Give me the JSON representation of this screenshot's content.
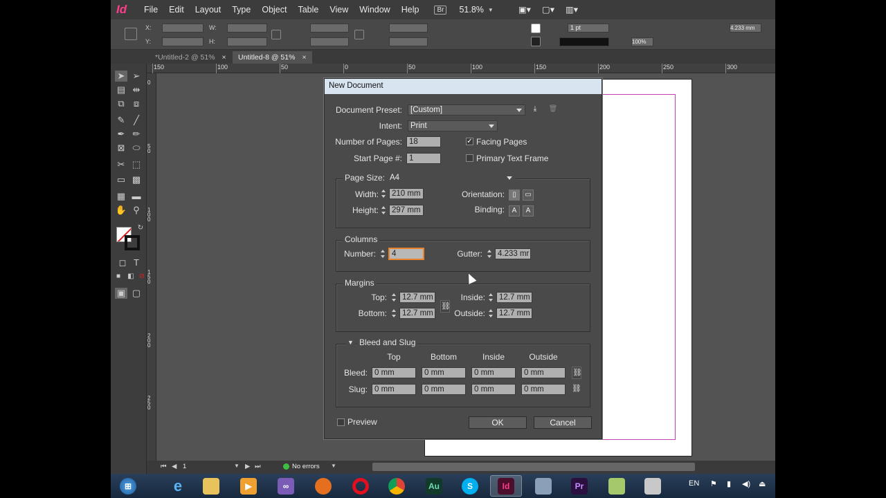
{
  "app": {
    "logo": "Id",
    "menus": [
      "File",
      "Edit",
      "Layout",
      "Type",
      "Object",
      "Table",
      "View",
      "Window",
      "Help"
    ],
    "bridge_badge": "Br",
    "zoom": "51.8%",
    "accent": "#ff3c8a"
  },
  "control_bar": {
    "x_label": "X:",
    "y_label": "Y:",
    "w_label": "W:",
    "h_label": "H:",
    "stroke_weight": "1 pt",
    "opacity": "100%",
    "spacing": "4.233 mm"
  },
  "tabs": [
    {
      "label": "*Untitled-2 @ 51%",
      "close": "×",
      "active": false
    },
    {
      "label": "Untitled-8 @ 51%",
      "close": "×",
      "active": true
    }
  ],
  "ruler_top": [
    "150",
    "100",
    "50",
    "0",
    "50",
    "100",
    "150",
    "200",
    "250",
    "300"
  ],
  "ruler_left": [
    "0",
    "5 0",
    "1 0 0",
    "1 5 0",
    "2 0 0",
    "2 5 0"
  ],
  "status": {
    "page": "1",
    "errors": "No errors"
  },
  "dialog": {
    "title": "New Document",
    "document_preset_label": "Document Preset:",
    "document_preset_value": "[Custom]",
    "intent_label": "Intent:",
    "intent_value": "Print",
    "num_pages_label": "Number of Pages:",
    "num_pages_value": "18",
    "start_page_label": "Start Page #:",
    "start_page_value": "1",
    "facing_pages_label": "Facing Pages",
    "facing_pages_checked": true,
    "primary_text_frame_label": "Primary Text Frame",
    "primary_text_frame_checked": false,
    "page_size_label": "Page Size:",
    "page_size_value": "A4",
    "width_label": "Width:",
    "width_value": "210 mm",
    "height_label": "Height:",
    "height_value": "297 mm",
    "orientation_label": "Orientation:",
    "binding_label": "Binding:",
    "columns_title": "Columns",
    "number_label": "Number:",
    "number_value": "4",
    "gutter_label": "Gutter:",
    "gutter_value": "4.233 mr",
    "margins_title": "Margins",
    "top_label": "Top:",
    "top_value": "12.7 mm",
    "bottom_label": "Bottom:",
    "bottom_value": "12.7 mm",
    "inside_label": "Inside:",
    "inside_value": "12.7 mm",
    "outside_label": "Outside:",
    "outside_value": "12.7 mm",
    "bleed_slug_title": "Bleed and Slug",
    "col_headers": [
      "Top",
      "Bottom",
      "Inside",
      "Outside"
    ],
    "bleed_label": "Bleed:",
    "bleed_values": [
      "0 mm",
      "0 mm",
      "0 mm",
      "0 mm"
    ],
    "slug_label": "Slug:",
    "slug_values": [
      "0 mm",
      "0 mm",
      "0 mm",
      "0 mm"
    ],
    "preview_label": "Preview",
    "ok_label": "OK",
    "cancel_label": "Cancel"
  },
  "taskbar": {
    "apps": [
      "start",
      "ie",
      "explorer",
      "media",
      "vs",
      "firefox",
      "opera",
      "chrome",
      "Au",
      "S",
      "Id",
      "tools",
      "Pr",
      "map",
      "tool2"
    ],
    "language": "EN"
  }
}
